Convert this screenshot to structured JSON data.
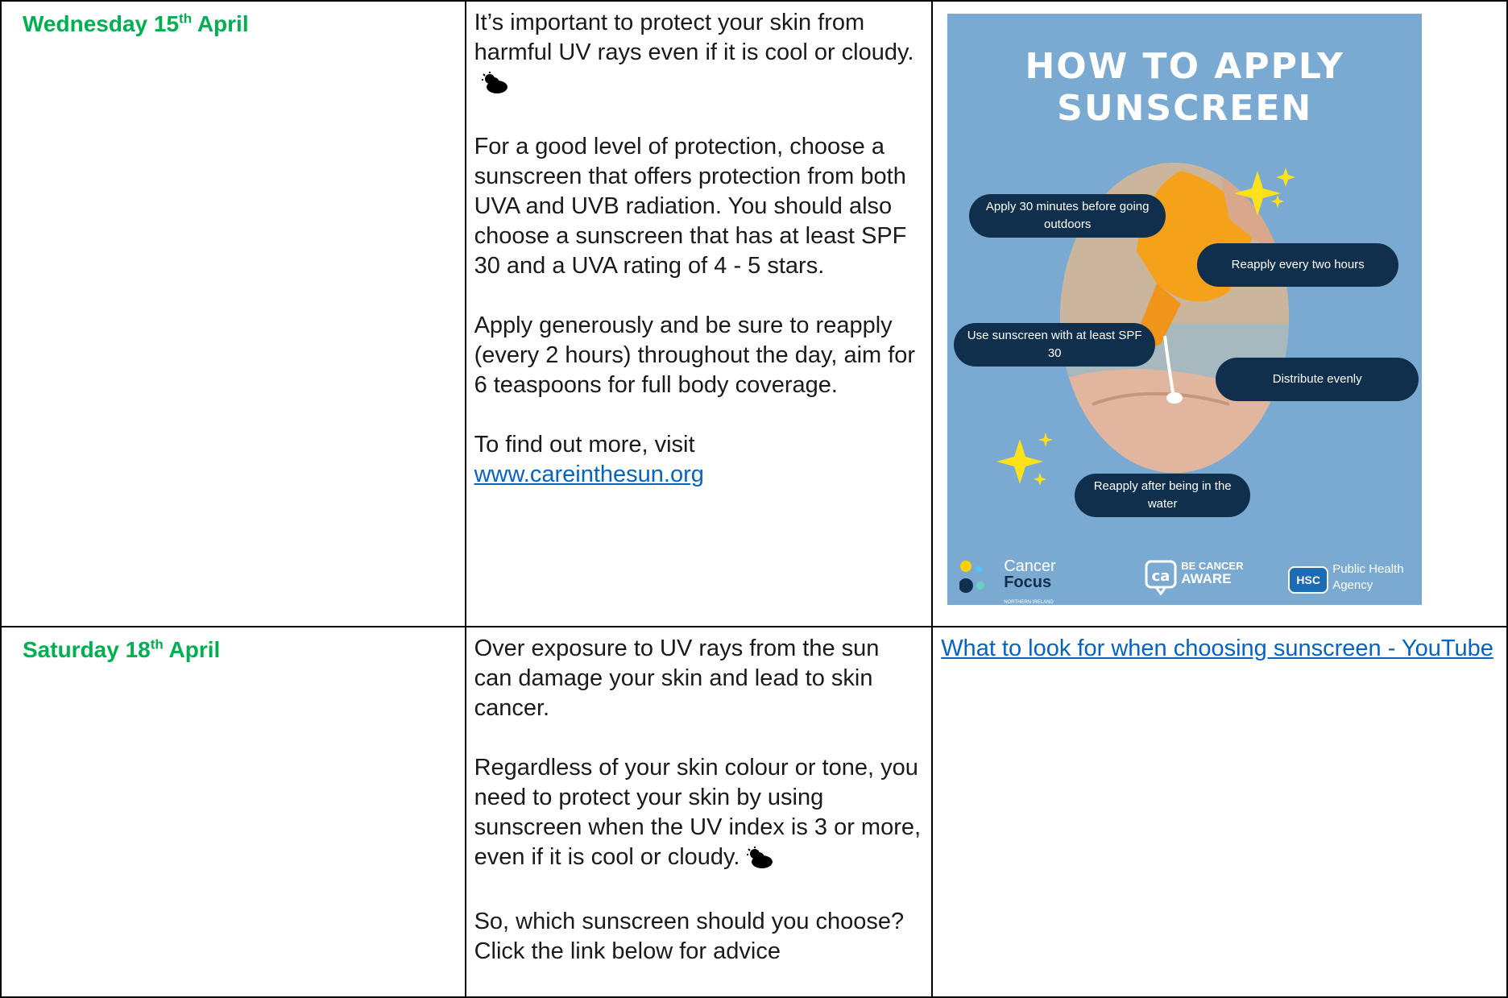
{
  "rows": [
    {
      "date": {
        "weekday": "Wednesday 15",
        "suffix": "th",
        "month": "April"
      },
      "paragraphs": [
        "It’s important to protect your skin from harmful UV rays even if it is cool or cloudy.",
        "For a good level of protection, choose a sunscreen that offers protection from both UVA and UVB radiation. You should also choose a sunscreen that has at least SPF 30 and a UVA rating of 4 - 5 stars.",
        "Apply generously and be sure to reapply (every 2 hours) throughout the day, aim for 6 teaspoons for full body coverage.",
        "To find out more, visit"
      ],
      "link": "www.careinthesun.org",
      "cloud_icon": "sun-behind-cloud-icon"
    },
    {
      "date": {
        "weekday": "Saturday 18",
        "suffix": "th",
        "month": "April"
      },
      "paragraphs": [
        "Over exposure to UV rays from the sun can damage your skin and lead to skin cancer.",
        "Regardless of your skin colour or tone, you need to protect your skin by using sunscreen when the UV index is 3 or more, even if it is cool or cloudy.",
        "So, which sunscreen should you choose? Click the link below for advice"
      ],
      "video_link": "What to look for when choosing sunscreen - YouTube",
      "cloud_icon": "sun-behind-cloud-icon"
    }
  ],
  "poster": {
    "title_line1": "HOW TO APPLY",
    "title_line2": "SUNSCREEN",
    "tips": [
      "Apply 30 minutes before going outdoors",
      "Reapply every two hours",
      "Use sunscreen with at least SPF 30",
      "Distribute evenly",
      "Reapply after being in the water"
    ],
    "logos": {
      "cancer_focus": [
        "Cancer",
        "Focus",
        "NORTHERN IRELAND"
      ],
      "be_cancer_aware": [
        "BE CANCER",
        "AWARE"
      ],
      "hsc": [
        "HSC",
        "Public Health",
        "Agency"
      ]
    },
    "colors": {
      "background": "#7aaad2",
      "pill": "#0f2f4d",
      "sparkle": "#ffe11a"
    }
  },
  "colors": {
    "date": "#00b050",
    "link": "#0563c1"
  }
}
